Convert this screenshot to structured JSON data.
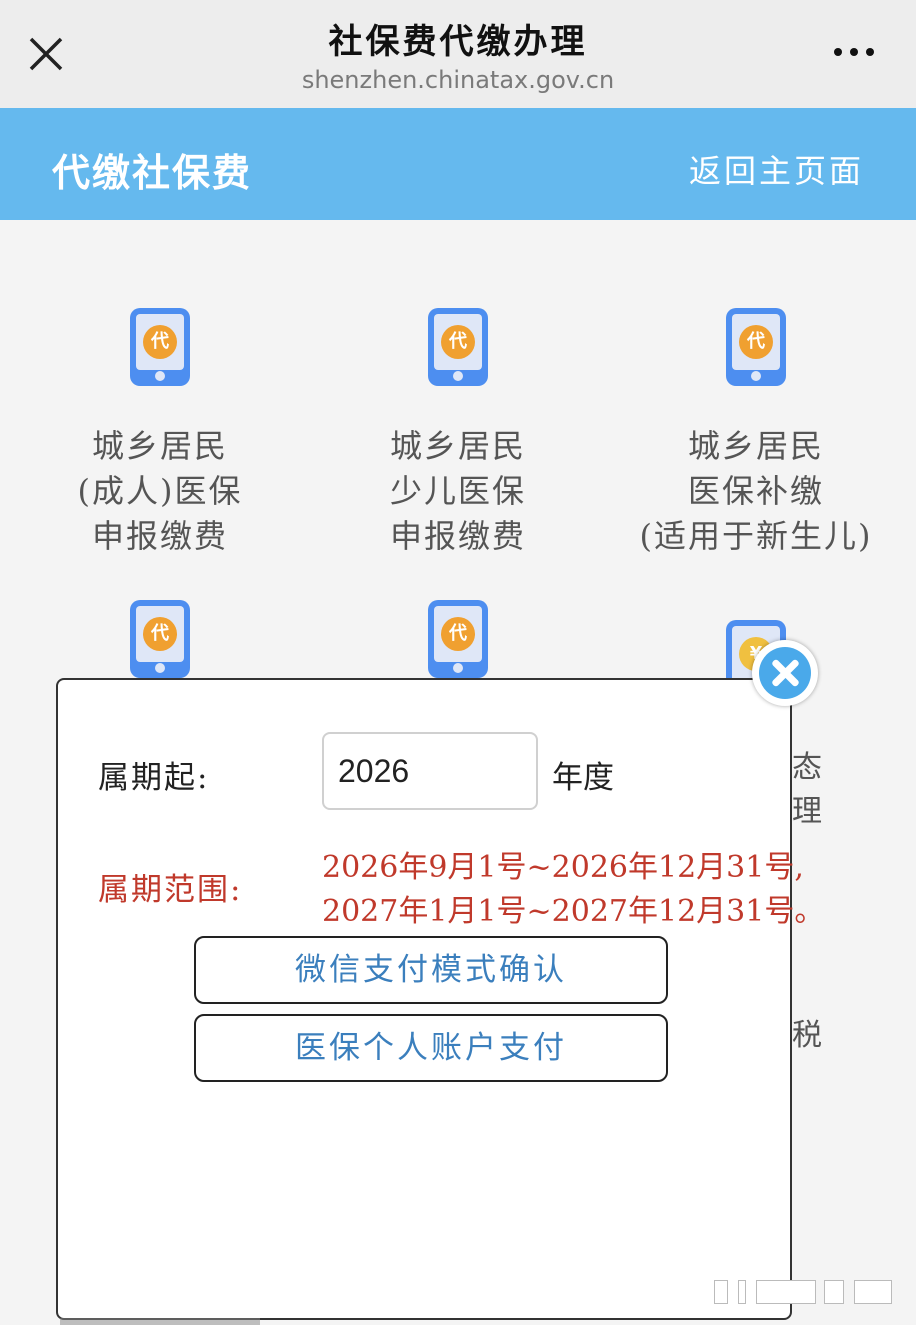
{
  "browser": {
    "title": "社保费代缴办理",
    "url": "shenzhen.chinatax.gov.cn",
    "close_icon": "close-icon",
    "more_icon": "more-icon"
  },
  "header": {
    "title": "代缴社保费",
    "back_label": "返回主页面",
    "color": "#65b9ee"
  },
  "grid": {
    "items": [
      {
        "badge": "代",
        "lines": [
          "城乡居民",
          "(成人)医保",
          "申报缴费"
        ]
      },
      {
        "badge": "代",
        "lines": [
          "城乡居民",
          "少儿医保",
          "申报缴费"
        ]
      },
      {
        "badge": "代",
        "lines": [
          "城乡居民",
          "医保补缴",
          "(适用于新生儿)"
        ]
      },
      {
        "badge": "代"
      },
      {
        "badge": "代"
      },
      {
        "badge": "¥"
      }
    ],
    "peek": [
      "态",
      "理",
      "税"
    ]
  },
  "modal": {
    "period_label": "属期起:",
    "year_value": "2026",
    "year_unit": "年度",
    "range_label": "属期范围:",
    "range_lines": [
      "2026年9月1号~2026年12月31号,",
      "2027年1月1号~2027年12月31号。"
    ],
    "buttons": {
      "wechat_confirm": "微信支付模式确认",
      "medical_account": "医保个人账户支付"
    },
    "close_icon": "close-circle-icon",
    "accent": "#c0392b"
  }
}
